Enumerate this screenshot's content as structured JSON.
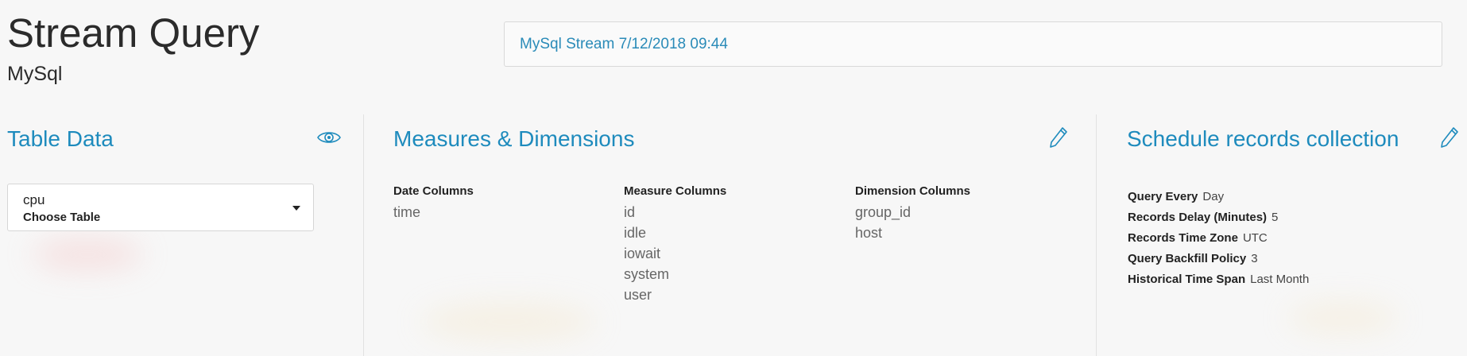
{
  "header": {
    "title": "Stream Query",
    "subtitle": "MySql",
    "stream_name": "MySql Stream 7/12/2018 09:44"
  },
  "table_data": {
    "title": "Table Data",
    "view_icon": "eye-icon",
    "select": {
      "value": "cpu",
      "label": "Choose Table"
    }
  },
  "measures_dimensions": {
    "title": "Measures & Dimensions",
    "edit_icon": "pencil-icon",
    "date_columns": {
      "header": "Date Columns",
      "items": [
        "time"
      ]
    },
    "measure_columns": {
      "header": "Measure Columns",
      "items": [
        "id",
        "idle",
        "iowait",
        "system",
        "user"
      ]
    },
    "dimension_columns": {
      "header": "Dimension Columns",
      "items": [
        "group_id",
        "host"
      ]
    }
  },
  "schedule": {
    "title": "Schedule records collection",
    "edit_icon": "pencil-icon",
    "items": [
      {
        "label": "Query Every",
        "value": "Day"
      },
      {
        "label": "Records Delay (Minutes)",
        "value": "5"
      },
      {
        "label": "Records Time Zone",
        "value": "UTC"
      },
      {
        "label": "Query Backfill Policy",
        "value": "3"
      },
      {
        "label": "Historical Time Span",
        "value": "Last Month"
      }
    ]
  },
  "colors": {
    "accent": "#1e8bbd",
    "link": "#2a8bb8",
    "background": "#f7f7f7"
  }
}
